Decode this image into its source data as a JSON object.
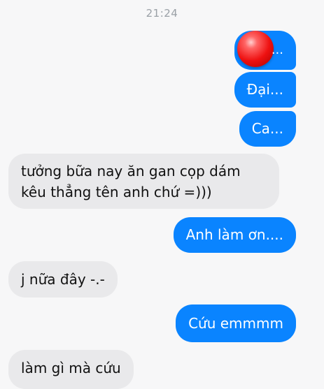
{
  "status": {
    "time": "21:24"
  },
  "messages": [
    {
      "id": "m1",
      "direction": "outgoing",
      "text": "..."
    },
    {
      "id": "m2",
      "direction": "outgoing",
      "text": "Đại..."
    },
    {
      "id": "m3",
      "direction": "outgoing",
      "text": "Ca..."
    },
    {
      "id": "m4",
      "direction": "incoming",
      "text": "tưởng bữa nay ăn gan cọp dám kêu thẳng tên anh chứ =)))"
    },
    {
      "id": "m5",
      "direction": "outgoing",
      "text": "Anh làm ơn...."
    },
    {
      "id": "m6",
      "direction": "incoming",
      "text": "j nữa đây -.-"
    },
    {
      "id": "m7",
      "direction": "outgoing",
      "text": "Cứu emmmm"
    },
    {
      "id": "m8",
      "direction": "incoming",
      "text": "làm gì mà cứu"
    }
  ],
  "colors": {
    "outgoing_bubble": "#0a84ff",
    "incoming_bubble": "#e9e9eb",
    "background": "#f7f7f8",
    "ball": "#ee1111"
  }
}
